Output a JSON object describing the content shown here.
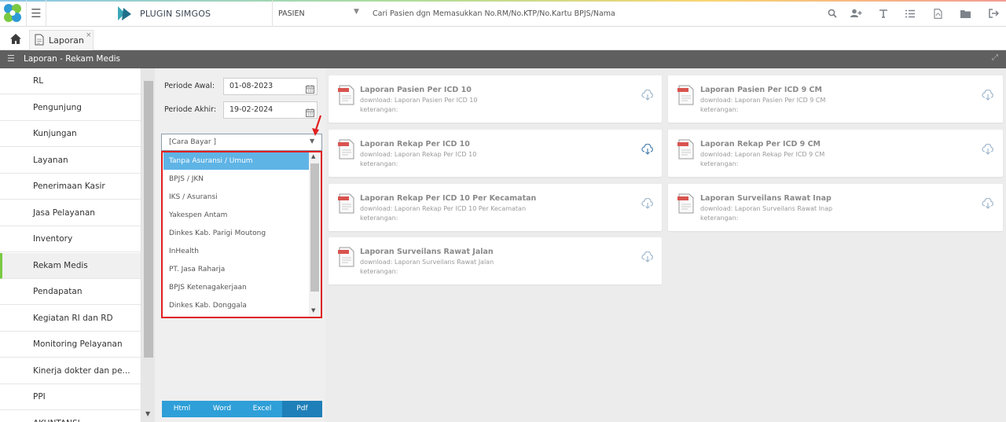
{
  "topbar": {
    "brand": "PLUGIN SIMGOS",
    "patient_type": "PASIEN",
    "search_placeholder": "Cari Pasien dgn Memasukkan No.RM/No.KTP/No.Kartu BPJS/Nama",
    "icons": [
      "search-icon",
      "add-user-icon",
      "text-icon",
      "list-icon",
      "pdf-file-icon",
      "folder-icon",
      "logout-icon"
    ]
  },
  "tabs": [
    {
      "label": "Laporan",
      "close": "×"
    }
  ],
  "page_title": "Laporan - Rekam Medis",
  "sidebar": {
    "items": [
      {
        "label": "RL"
      },
      {
        "label": "Pengunjung"
      },
      {
        "label": "Kunjungan"
      },
      {
        "label": "Layanan"
      },
      {
        "label": "Penerimaan Kasir"
      },
      {
        "label": "Jasa Pelayanan"
      },
      {
        "label": "Inventory"
      },
      {
        "label": "Rekam Medis",
        "active": true
      },
      {
        "label": "Pendapatan"
      },
      {
        "label": "Kegiatan RI dan RD"
      },
      {
        "label": "Monitoring Pelayanan"
      },
      {
        "label": "Kinerja dokter dan pe..."
      },
      {
        "label": "PPI"
      },
      {
        "label": "AKUNTANSI"
      }
    ]
  },
  "filter": {
    "periode_awal_label": "Periode Awal:",
    "periode_awal_value": "01-08-2023",
    "periode_akhir_label": "Periode Akhir:",
    "periode_akhir_value": "19-02-2024",
    "cara_bayar_placeholder": "[Cara Bayar ]",
    "cara_bayar_options": [
      "Tanpa Asuransi / Umum",
      "BPJS / JKN",
      "IKS / Asuransi",
      "Yakespen Antam",
      "Dinkes Kab. Parigi Moutong",
      "InHealth",
      "PT. Jasa Raharja",
      "BPJS Ketenagakerjaan",
      "Dinkes Kab. Donggala"
    ],
    "selected_option": "Tanpa Asuransi / Umum",
    "buttons": {
      "html": "Html",
      "word": "Word",
      "excel": "Excel",
      "pdf": "Pdf"
    }
  },
  "reports": [
    {
      "title": "Laporan Pasien Per ICD 10",
      "download": "download: Laporan Pasien Per ICD 10",
      "keterangan": "keterangan:"
    },
    {
      "title": "Laporan Pasien Per ICD 9 CM",
      "download": "download: Laporan Pasien Per ICD 9 CM",
      "keterangan": "keterangan:"
    },
    {
      "title": "Laporan Rekap Per ICD 10",
      "download": "download: Laporan Rekap Per ICD 10",
      "keterangan": "keterangan:"
    },
    {
      "title": "Laporan Rekap Per ICD 9 CM",
      "download": "download: Laporan Rekap Per ICD 9 CM",
      "keterangan": "keterangan:"
    },
    {
      "title": "Laporan Rekap Per ICD 10 Per Kecamatan",
      "download": "download: Laporan Rekap Per ICD 10 Per Kecamatan",
      "keterangan": "keterangan:"
    },
    {
      "title": "Laporan Surveilans Rawat Inap",
      "download": "download: Laporan Surveilans Rawat Inap",
      "keterangan": "keterangan:"
    },
    {
      "title": "Laporan Surveilans Rawat Jalan",
      "download": "download: Laporan Surveilans Rawat Jalan",
      "keterangan": "keterangan:"
    }
  ],
  "colors": {
    "accent": "#2e9fd8",
    "highlight_border": "#e02020",
    "active_bar": "#7ac943",
    "header_strip": "#5f5f5f"
  }
}
